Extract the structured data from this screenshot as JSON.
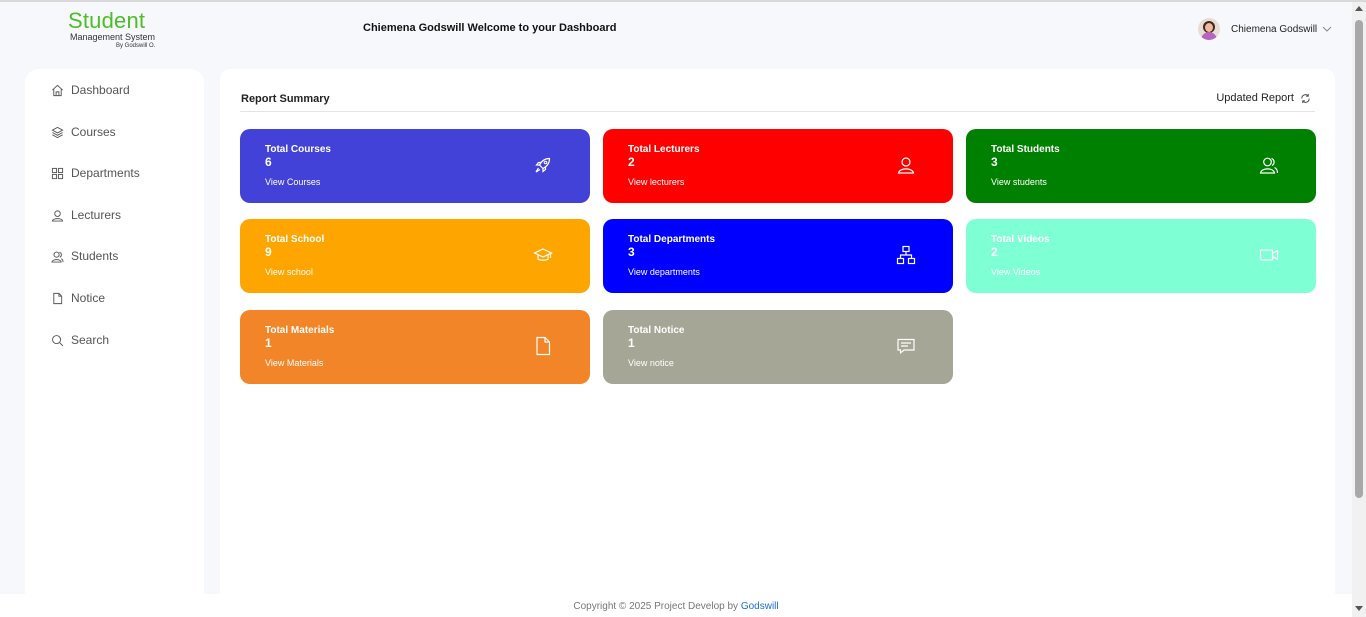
{
  "header": {
    "logo_title": "Student",
    "logo_subtitle": "Management System",
    "logo_by": "By Godswill O.",
    "welcome": "Chiemena Godswill Welcome to your Dashboard",
    "user_name": "Chiemena Godswill"
  },
  "sidebar": {
    "items": [
      {
        "label": "Dashboard",
        "icon": "home-icon"
      },
      {
        "label": "Courses",
        "icon": "layers-icon"
      },
      {
        "label": "Departments",
        "icon": "grid-icon"
      },
      {
        "label": "Lecturers",
        "icon": "user-icon"
      },
      {
        "label": "Students",
        "icon": "users-icon"
      },
      {
        "label": "Notice",
        "icon": "file-icon"
      },
      {
        "label": "Search",
        "icon": "search-icon"
      }
    ]
  },
  "main": {
    "title": "Report Summary",
    "updated": "Updated Report",
    "cards": [
      {
        "title": "Total Courses",
        "count": "6",
        "link": "View Courses",
        "color": "#4242d8",
        "icon": "rocket-icon"
      },
      {
        "title": "Total Lecturers",
        "count": "2",
        "link": "View lecturers",
        "color": "#ff0000",
        "icon": "user-icon"
      },
      {
        "title": "Total Students",
        "count": "3",
        "link": "View students",
        "color": "#008000",
        "icon": "users-icon"
      },
      {
        "title": "Total School",
        "count": "9",
        "link": "View school",
        "color": "#ffa500",
        "icon": "graduation-cap-icon"
      },
      {
        "title": "Total Departments",
        "count": "3",
        "link": "View departments",
        "color": "#0000ff",
        "icon": "sitemap-icon"
      },
      {
        "title": "Total Videos",
        "count": "2",
        "link": "View Videos",
        "color": "#7fffd4",
        "icon": "video-icon"
      },
      {
        "title": "Total Materials",
        "count": "1",
        "link": "View Materials",
        "color": "#f28527",
        "icon": "file-icon"
      },
      {
        "title": "Total Notice",
        "count": "1",
        "link": "View notice",
        "color": "#a6a696",
        "icon": "message-icon"
      }
    ]
  },
  "footer": {
    "text": "Copyright © 2025 Project Develop by",
    "link": "Godswill"
  }
}
